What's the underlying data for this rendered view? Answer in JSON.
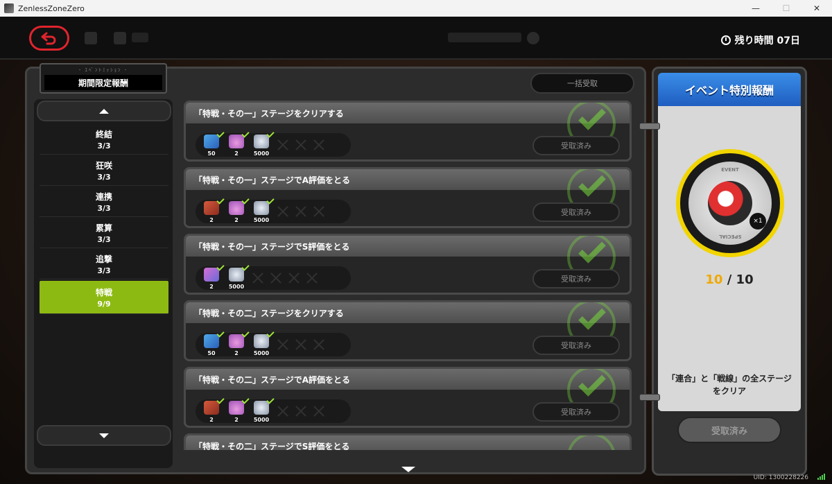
{
  "window": {
    "title": "ZenlessZoneZero",
    "controls": [
      "—",
      "☐",
      "✕"
    ]
  },
  "topbar": {
    "timer_label": "残り時間 07日"
  },
  "panel": {
    "tab_subtitle": "- ｴﾍﾞﾝﾄﾐｯｼｮﾝ -",
    "tab_title": "期間限定報酬",
    "claim_all_label": "一括受取"
  },
  "sidebar": {
    "items": [
      {
        "name": "終結",
        "count": "3/3"
      },
      {
        "name": "狂咲",
        "count": "3/3"
      },
      {
        "name": "連携",
        "count": "3/3"
      },
      {
        "name": "累算",
        "count": "3/3"
      },
      {
        "name": "追撃",
        "count": "3/3"
      },
      {
        "name": "特戦",
        "count": "9/9",
        "active": true
      }
    ]
  },
  "missions": [
    {
      "title": "「特戦・その一」ステージをクリアする",
      "rewards": [
        {
          "icon": "ticket-icon",
          "qty": "50"
        },
        {
          "icon": "potion-icon",
          "qty": "2"
        },
        {
          "icon": "coin-icon",
          "qty": "5000"
        }
      ],
      "button": "受取済み"
    },
    {
      "title": "「特戦・その一」ステージでA評価をとる",
      "rewards": [
        {
          "icon": "book-icon",
          "qty": "2"
        },
        {
          "icon": "potion-icon",
          "qty": "2"
        },
        {
          "icon": "coin-icon",
          "qty": "5000"
        }
      ],
      "button": "受取済み"
    },
    {
      "title": "「特戦・その一」ステージでS評価をとる",
      "rewards": [
        {
          "icon": "car-icon",
          "qty": "2"
        },
        {
          "icon": "coin-icon",
          "qty": "5000"
        }
      ],
      "button": "受取済み"
    },
    {
      "title": "「特戦・その二」ステージをクリアする",
      "rewards": [
        {
          "icon": "ticket-icon",
          "qty": "50"
        },
        {
          "icon": "potion-icon",
          "qty": "2"
        },
        {
          "icon": "coin-icon",
          "qty": "5000"
        }
      ],
      "button": "受取済み"
    },
    {
      "title": "「特戦・その二」ステージでA評価をとる",
      "rewards": [
        {
          "icon": "book-icon",
          "qty": "2"
        },
        {
          "icon": "potion-icon",
          "qty": "2"
        },
        {
          "icon": "coin-icon",
          "qty": "5000"
        }
      ],
      "button": "受取済み"
    },
    {
      "title": "「特戦・その二」ステージでS評価をとる",
      "rewards": [],
      "button": ""
    }
  ],
  "special": {
    "header": "イベント特別報酬",
    "medal_top": "EVENT",
    "medal_bottom": "SPECIAL",
    "multiplier": "×1",
    "progress_current": "10",
    "progress_sep": " / ",
    "progress_total": "10",
    "condition": "「連合」と「戦線」の全ステージをクリア",
    "button": "受取済み"
  },
  "footer": {
    "uid": "UID: 1300228226"
  },
  "colors": {
    "accent_green": "#8dba12",
    "back_red": "#e0242d",
    "special_blue": "#3a8ee8",
    "medal_yellow": "#f1d400"
  }
}
